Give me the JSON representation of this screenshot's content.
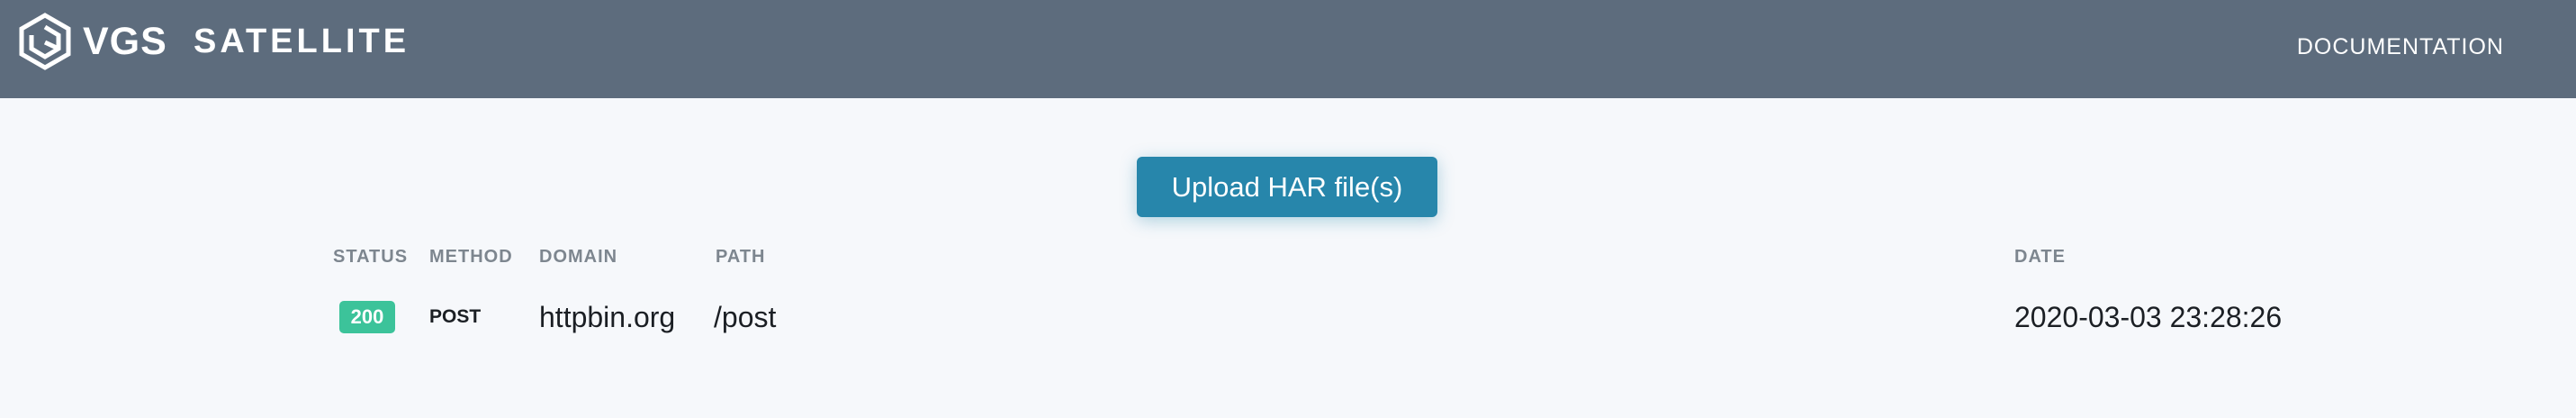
{
  "header": {
    "logo_text": "VGS",
    "product_name": "SATELLITE",
    "nav_documentation": "DOCUMENTATION",
    "logo_icon": "vgs-hexagon-logo"
  },
  "upload": {
    "label": "Upload HAR file(s)"
  },
  "table": {
    "columns": [
      "STATUS",
      "METHOD",
      "DOMAIN",
      "PATH",
      "DATE"
    ],
    "rows": [
      {
        "status": "200",
        "method": "POST",
        "domain": "httpbin.org",
        "path": "/post",
        "date": "2020-03-03 23:28:26"
      }
    ]
  },
  "colors": {
    "header_bg": "#5d6c7d",
    "page_bg": "#f6f8fb",
    "button_bg": "#2786ab",
    "status_ok": "#3cc39a",
    "column_header_text": "#7d868f"
  }
}
